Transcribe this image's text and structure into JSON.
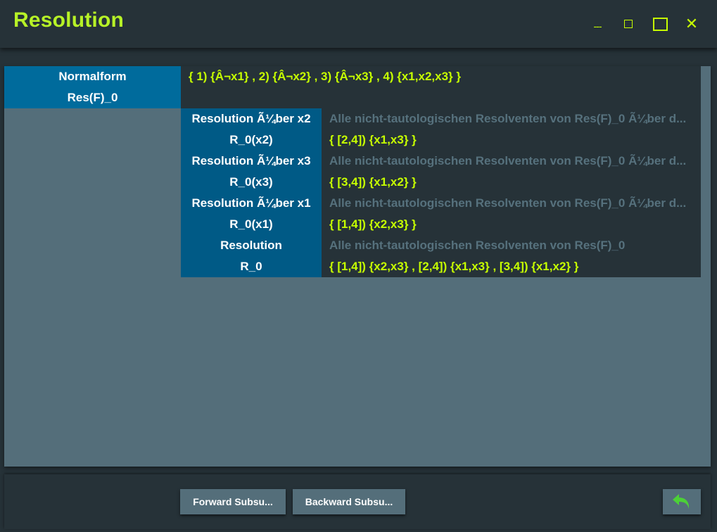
{
  "window": {
    "title": "Resolution",
    "controls": {
      "minimize": "---",
      "close": "✕"
    },
    "colors": {
      "accent": "#c6ff00",
      "header_blue": "#006b9c",
      "sub_blue": "#005a86",
      "panel": "#546e7a",
      "dark": "#263238"
    }
  },
  "normalform": {
    "label_top": "Normalform",
    "label_bottom": "Res(F)_0",
    "value": "{  1) {Â¬x1}  ,  2) {Â¬x2}  ,  3) {Â¬x3}  ,  4) {x1,x2,x3}  }"
  },
  "rows": [
    {
      "title": "Resolution Ã¼ber x2",
      "name": "R_0(x2)",
      "description": "Alle nicht-tautologischen Resolventen von Res(F)_0 Ã¼ber d...",
      "value": "{  [2,4]) {x1,x3}  }"
    },
    {
      "title": "Resolution Ã¼ber x3",
      "name": "R_0(x3)",
      "description": "Alle nicht-tautologischen Resolventen von Res(F)_0 Ã¼ber d...",
      "value": "{  [3,4]) {x1,x2}  }"
    },
    {
      "title": "Resolution Ã¼ber x1",
      "name": "R_0(x1)",
      "description": "Alle nicht-tautologischen Resolventen von Res(F)_0 Ã¼ber d...",
      "value": "{  [1,4]) {x2,x3}  }"
    },
    {
      "title": "Resolution",
      "name": "R_0",
      "description": "Alle nicht-tautologischen Resolventen von Res(F)_0",
      "value": "{  [1,4]) {x2,x3}  ,  [2,4]) {x1,x3}  ,  [3,4]) {x1,x2}  }"
    }
  ],
  "footer": {
    "forward_label": "Forward Subsu...",
    "backward_label": "Backward Subsu...",
    "undo_icon": "undo-arrow-icon"
  }
}
